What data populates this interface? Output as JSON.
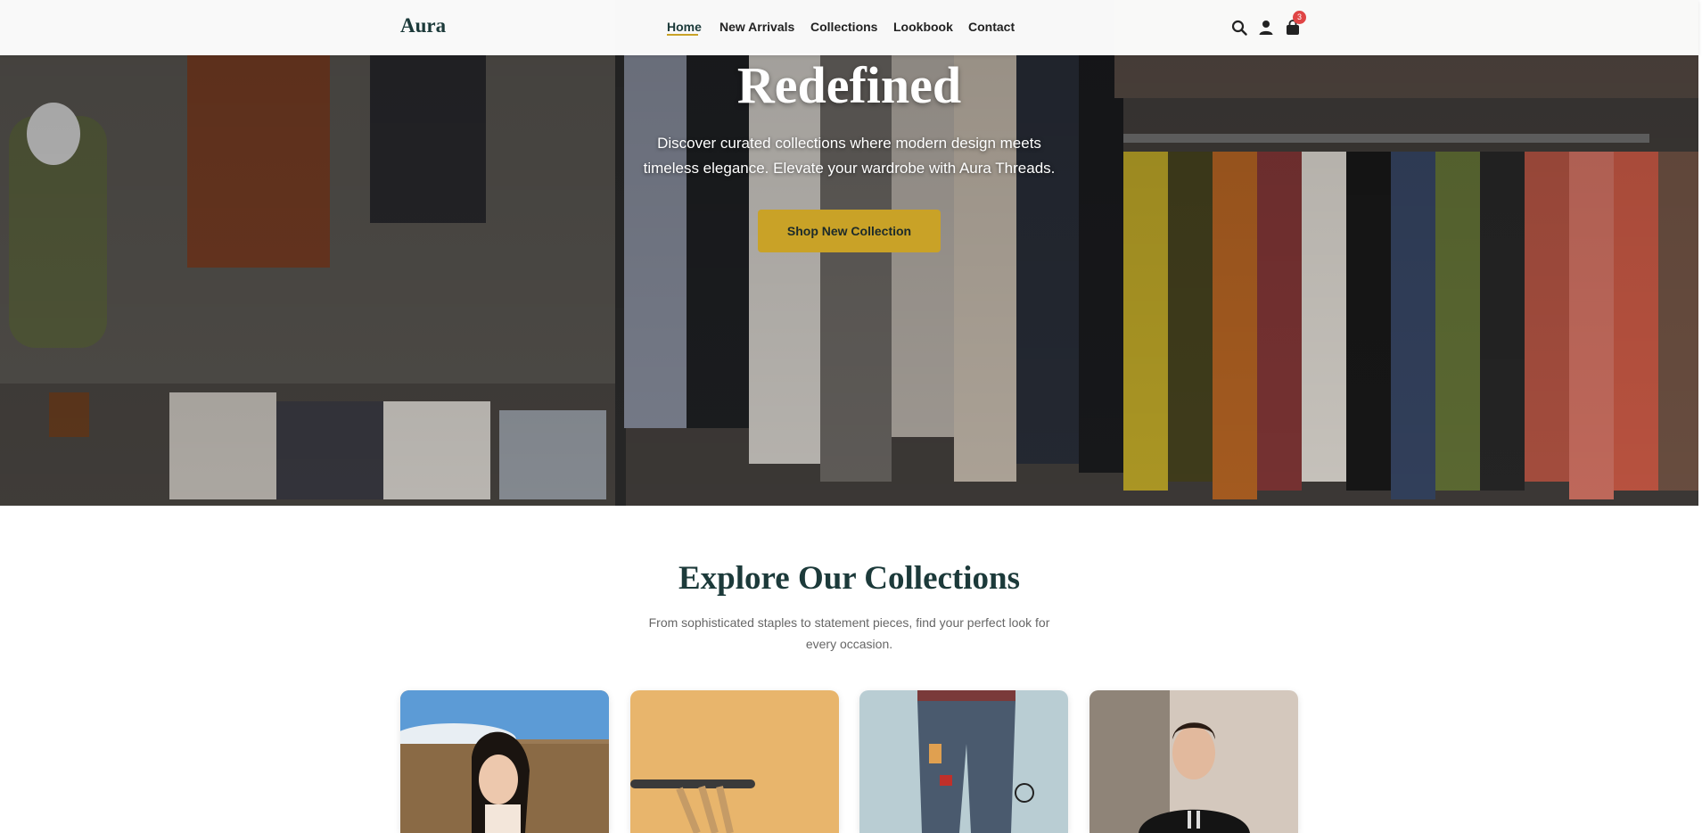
{
  "header": {
    "logo": "Aura",
    "nav": [
      {
        "label": "Home",
        "active": true
      },
      {
        "label": "New Arrivals",
        "active": false
      },
      {
        "label": "Collections",
        "active": false
      },
      {
        "label": "Lookbook",
        "active": false
      },
      {
        "label": "Contact",
        "active": false
      }
    ],
    "icons": [
      "search-icon",
      "user-icon",
      "shopping-bag-icon"
    ],
    "cart_count": "3"
  },
  "hero": {
    "title": "Redefined",
    "text": "Discover curated collections where modern design meets timeless elegance. Elevate your wardrobe with Aura Threads.",
    "cta_label": "Shop New Collection"
  },
  "collections": {
    "title": "Explore Our Collections",
    "subtitle": "From sophisticated staples to statement pieces, find your perfect look for every occasion."
  },
  "colors": {
    "brand_dark": "#1c3a3a",
    "accent_gold": "#c9a227",
    "badge_red": "#e04545"
  }
}
